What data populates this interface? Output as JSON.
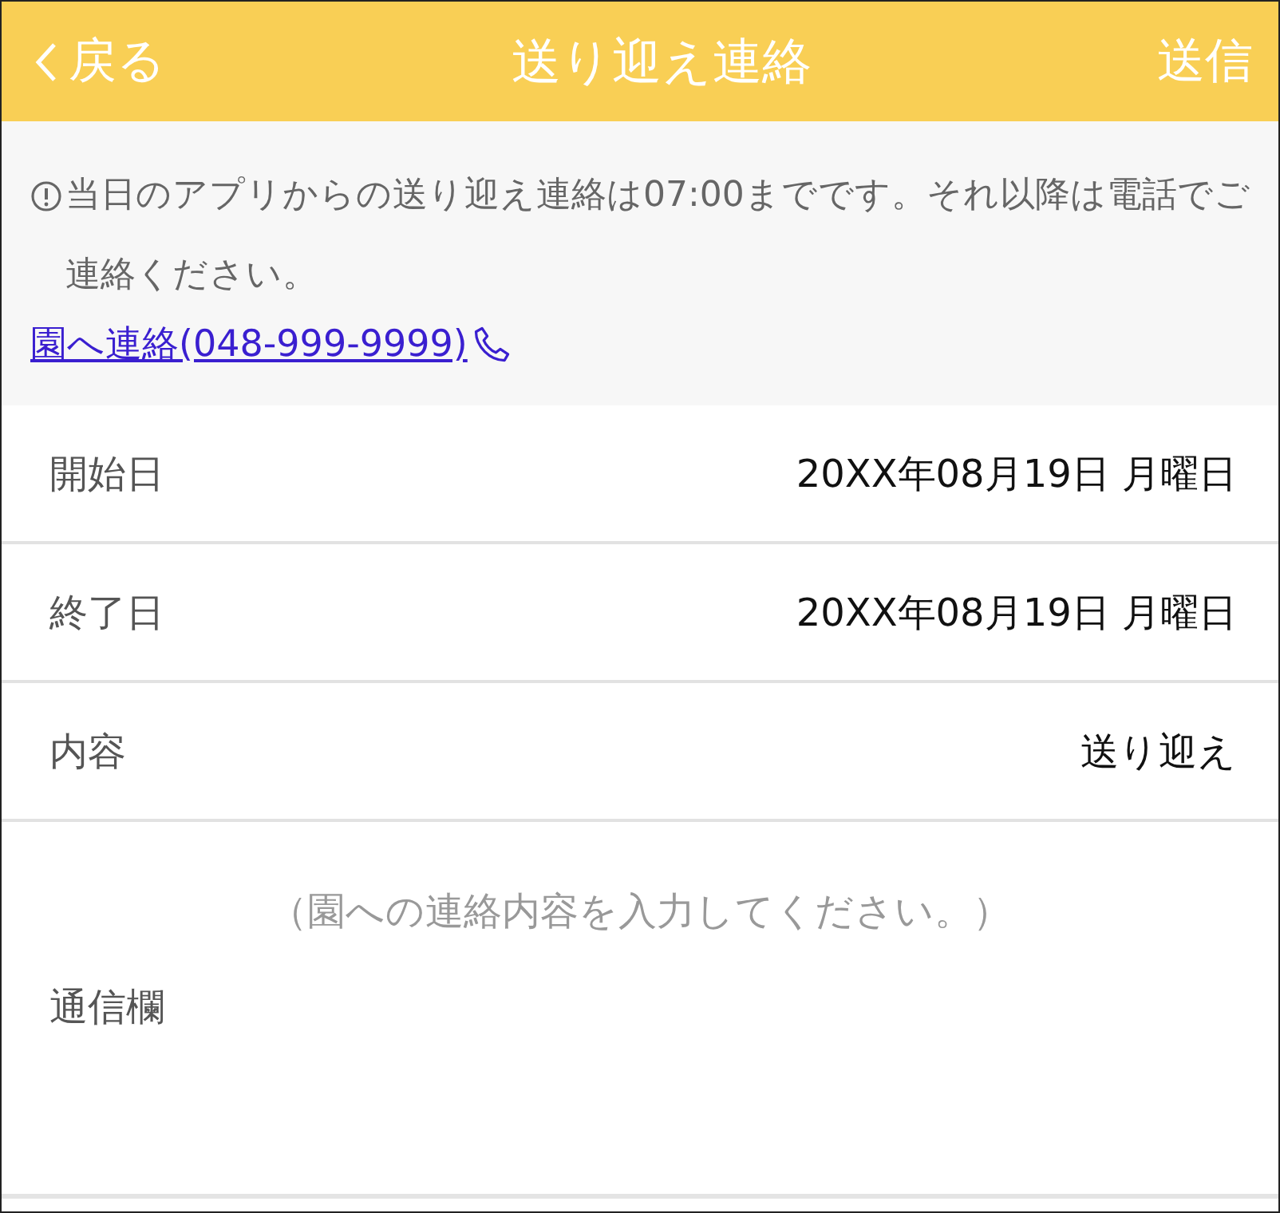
{
  "header": {
    "back": "戻る",
    "title": "送り迎え連絡",
    "action": "送信"
  },
  "notice": {
    "text": "当日のアプリからの送り迎え連絡は07:00までです。それ以降は電話でご連絡ください。",
    "link": "園へ連絡(048-999-9999)"
  },
  "fields": [
    {
      "label": "開始日",
      "value": "20XX年08月19日 月曜日"
    },
    {
      "label": "終了日",
      "value": "20XX年08月19日 月曜日"
    },
    {
      "label": "内容",
      "value": "送り迎え"
    }
  ],
  "message": {
    "label": "通信欄",
    "placeholder": "（園への連絡内容を入力してください。）"
  }
}
